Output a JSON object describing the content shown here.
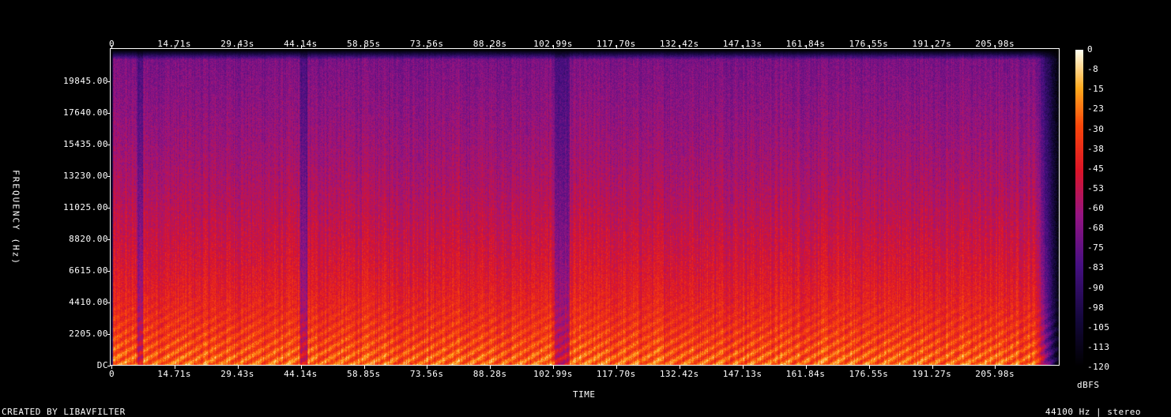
{
  "chart_data": {
    "type": "heatmap",
    "title": "",
    "xlabel": "TIME",
    "ylabel": "FREQUENCY (Hz)",
    "x_ticks": [
      "0",
      "14.71s",
      "29.43s",
      "44.14s",
      "58.85s",
      "73.56s",
      "88.28s",
      "102.99s",
      "117.70s",
      "132.42s",
      "147.13s",
      "161.84s",
      "176.55s",
      "191.27s",
      "205.98s"
    ],
    "x_tick_values": [
      0,
      14.71,
      29.43,
      44.14,
      58.85,
      73.56,
      88.28,
      102.99,
      117.7,
      132.42,
      147.13,
      161.84,
      176.55,
      191.27,
      205.98
    ],
    "xlim": [
      0,
      221
    ],
    "y_ticks": [
      "DC",
      "2205.00",
      "4410.00",
      "6615.00",
      "8820.00",
      "11025.00",
      "13230.00",
      "15435.00",
      "17640.00",
      "19845.00"
    ],
    "y_tick_values": [
      0,
      2205,
      4410,
      6615,
      8820,
      11025,
      13230,
      15435,
      17640,
      19845
    ],
    "ylim": [
      0,
      22050
    ],
    "colorbar": {
      "label": "dBFS",
      "ticks": [
        "0",
        "-8",
        "-15",
        "-23",
        "-30",
        "-38",
        "-45",
        "-53",
        "-60",
        "-68",
        "-75",
        "-83",
        "-90",
        "-98",
        "-105",
        "-113",
        "-120"
      ],
      "range": [
        -120,
        0
      ]
    },
    "colors": {
      "low": "#000000",
      "mid_low": "#2a0a6e",
      "mid": "#8a1a8a",
      "mid_high": "#e0200a",
      "high": "#ffb020",
      "max": "#ffffff"
    }
  },
  "footer": {
    "left": "CREATED BY LIBAVFILTER",
    "right": "44100 Hz | stereo"
  }
}
